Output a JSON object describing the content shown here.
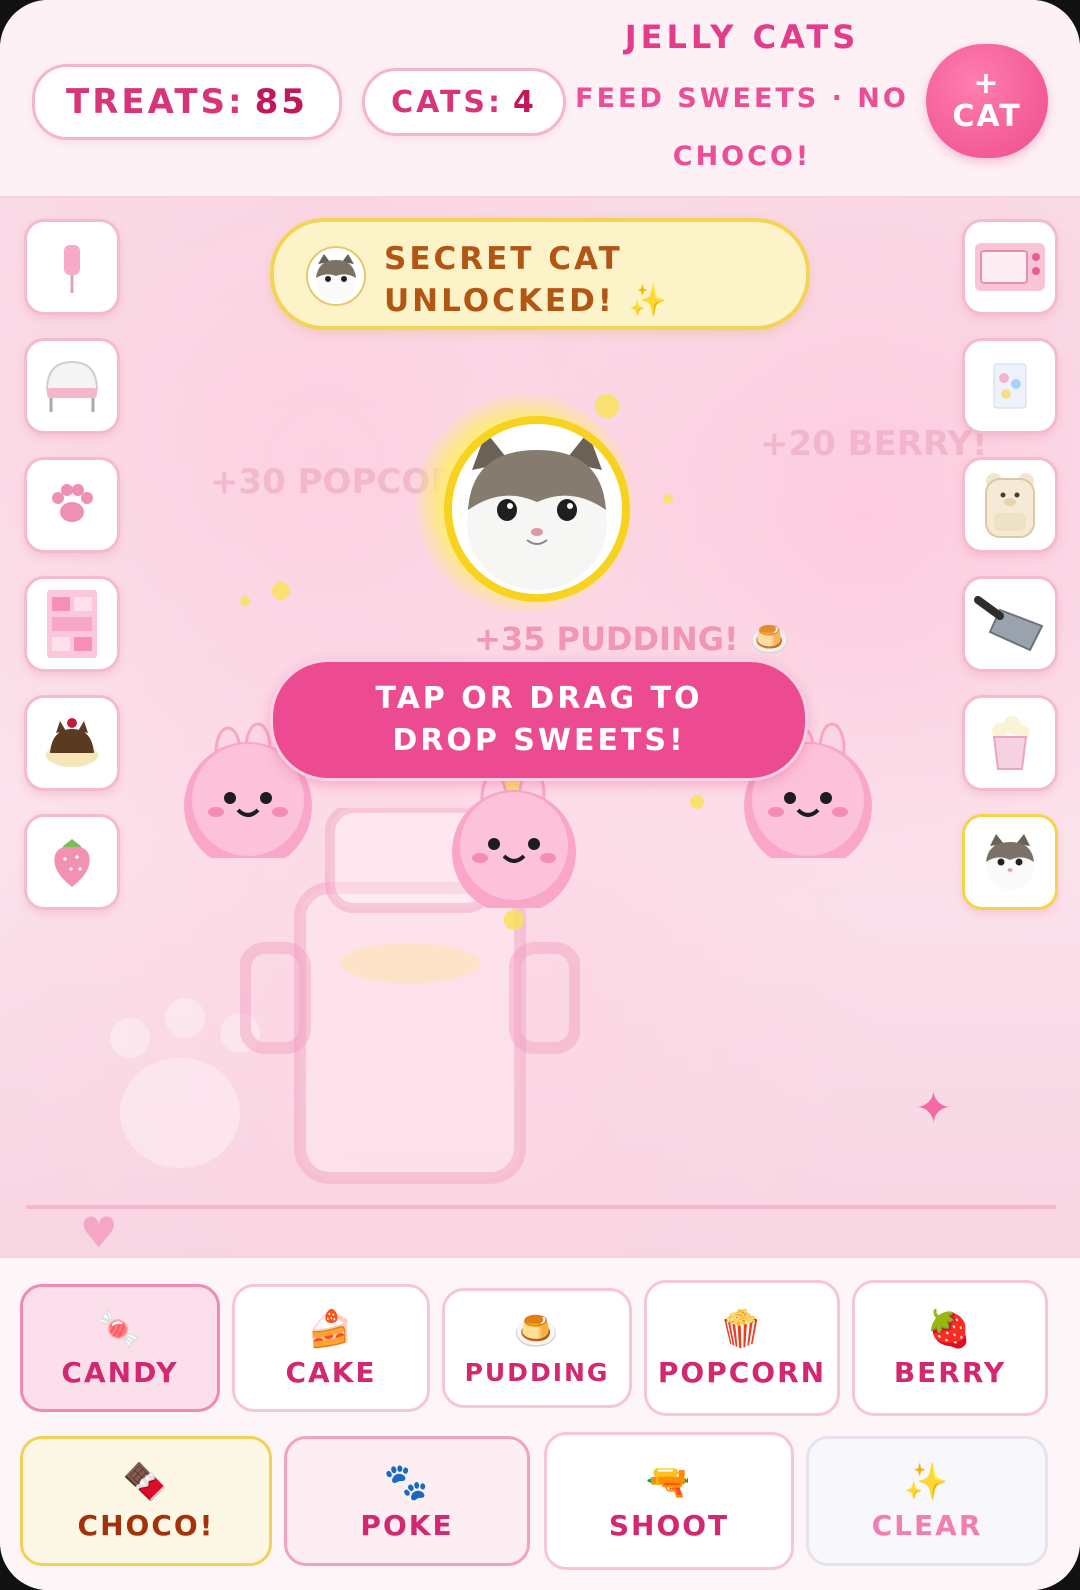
{
  "header": {
    "treats_label": "Treats:",
    "treats_value": "85",
    "cats_label": "Cats:",
    "cats_value": "4",
    "title": "Jelly Cats",
    "subtitle": "Feed sweets · no choco!",
    "add_cat_plus": "+",
    "add_cat_label": "Cat"
  },
  "banner": {
    "text": "Secret cat unlocked! ✨"
  },
  "play": {
    "floating_pudding": "+35 PUDDING! 🍮",
    "ghost_popcorn": "+30 POPCORN",
    "ghost_berry": "+20 BERRY!",
    "hint": "Tap or drag to drop sweets!"
  },
  "left_slots": [
    "cotton-candy-icon",
    "chair-icon",
    "paw-cushion-icon",
    "sticker-sheet-icon",
    "cat-pudding-icon",
    "strawberry-icon"
  ],
  "right_slots": [
    "pink-oven-icon",
    "sticker-pack-icon",
    "bear-backpack-icon",
    "cleaver-icon",
    "popcorn-cup-icon",
    "secret-cat-icon"
  ],
  "tools": {
    "candy": {
      "icon": "🍬",
      "label": "Candy"
    },
    "cake": {
      "icon": "🍰",
      "label": "Cake"
    },
    "pudding": {
      "icon": "🍮",
      "label": "Pudding"
    },
    "popcorn": {
      "icon": "🍿",
      "label": "Popcorn"
    },
    "berry": {
      "icon": "🍓",
      "label": "Berry"
    },
    "choco": {
      "icon": "🍫",
      "label": "Choco!"
    },
    "poke": {
      "icon": "🐾",
      "label": "Poke"
    },
    "shoot": {
      "icon": "🔫",
      "label": "Shoot"
    },
    "clear": {
      "icon": "✨",
      "label": "Clear"
    }
  },
  "colors": {
    "accent": "#ec4b91",
    "banner_bg": "#fdf3c8",
    "banner_text": "#b25614",
    "selected_slot": "#f5d44a"
  }
}
